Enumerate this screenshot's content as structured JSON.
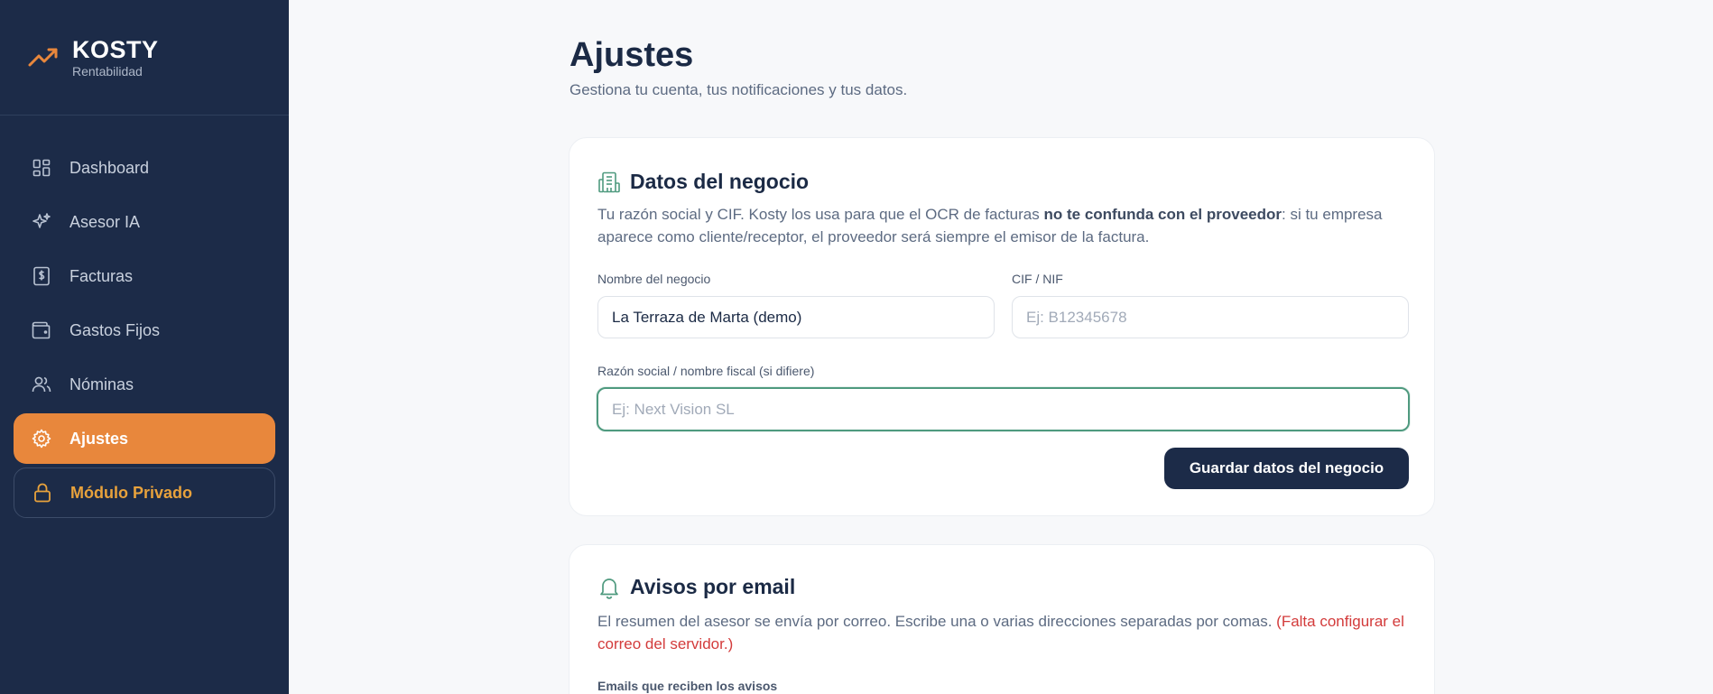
{
  "brand": {
    "name": "KOSTY",
    "subtitle": "Rentabilidad"
  },
  "sidebar": {
    "items": [
      {
        "label": "Dashboard",
        "icon": "dashboard-icon"
      },
      {
        "label": "Asesor IA",
        "icon": "sparkles-icon"
      },
      {
        "label": "Facturas",
        "icon": "invoice-icon"
      },
      {
        "label": "Gastos Fijos",
        "icon": "wallet-icon"
      },
      {
        "label": "Nóminas",
        "icon": "users-icon"
      },
      {
        "label": "Ajustes",
        "icon": "gear-icon",
        "active": true
      },
      {
        "label": "Módulo Privado",
        "icon": "lock-icon"
      }
    ]
  },
  "page": {
    "title": "Ajustes",
    "subtitle": "Gestiona tu cuenta, tus notificaciones y tus datos."
  },
  "business_card": {
    "title": "Datos del negocio",
    "desc_part1": "Tu razón social y CIF. Kosty los usa para que el OCR de facturas ",
    "desc_bold": "no te confunda con el proveedor",
    "desc_part2": ": si tu empresa aparece como cliente/receptor, el proveedor será siempre el emisor de la factura.",
    "name_label": "Nombre del negocio",
    "name_value": "La Terraza de Marta (demo)",
    "cif_label": "CIF / NIF",
    "cif_placeholder": "Ej: B12345678",
    "razon_label": "Razón social / nombre fiscal (si difiere)",
    "razon_placeholder": "Ej: Next Vision SL",
    "save_label": "Guardar datos del negocio"
  },
  "email_card": {
    "title": "Avisos por email",
    "desc": "El resumen del asesor se envía por correo. Escribe una o varias direcciones separadas por comas. ",
    "warning": "(Falta configurar el correo del servidor.)",
    "emails_label": "Emails que reciben los avisos"
  },
  "colors": {
    "sidebar_bg": "#1c2b48",
    "accent": "#e8873c",
    "private_text": "#e8a23c",
    "focus": "#4f9a7f",
    "warning": "#d33b3b"
  }
}
